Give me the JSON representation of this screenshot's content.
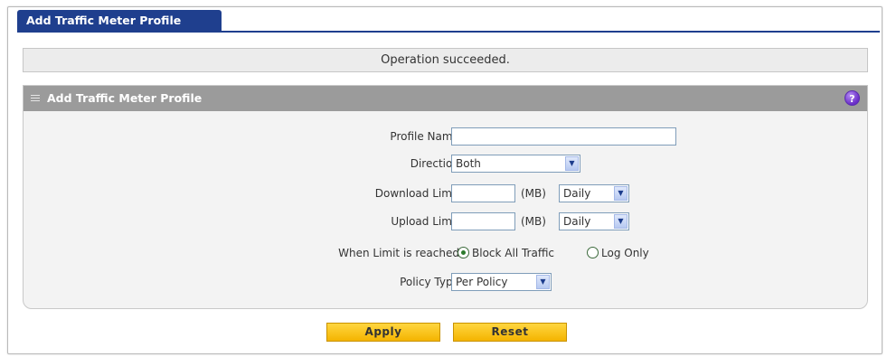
{
  "tab": {
    "label": "Add Traffic Meter Profile"
  },
  "status": {
    "message": "Operation succeeded."
  },
  "panel": {
    "title": "Add Traffic Meter Profile",
    "help_glyph": "?"
  },
  "form": {
    "profile_name": {
      "label": "Profile Name:",
      "value": ""
    },
    "direction": {
      "label": "Direction:",
      "value": "Both"
    },
    "download_limit": {
      "label": "Download Limit:",
      "value": "",
      "unit": "(MB)",
      "period": "Daily"
    },
    "upload_limit": {
      "label": "Upload Limit:",
      "value": "",
      "unit": "(MB)",
      "period": "Daily"
    },
    "limit_reached": {
      "label": "When Limit is reached:",
      "options": [
        "Block All Traffic",
        "Log Only"
      ],
      "selected": "Block All Traffic"
    },
    "policy_type": {
      "label": "Policy Type:",
      "value": "Per Policy"
    }
  },
  "buttons": {
    "apply": "Apply",
    "reset": "Reset"
  },
  "icons": {
    "dropdown": "chevron-down-icon",
    "help": "help-icon",
    "grip": "grip-icon"
  },
  "colors": {
    "tab_bg": "#1f3f8e",
    "header_bg": "#9b9b9b",
    "button_bg": "#f4b400"
  }
}
